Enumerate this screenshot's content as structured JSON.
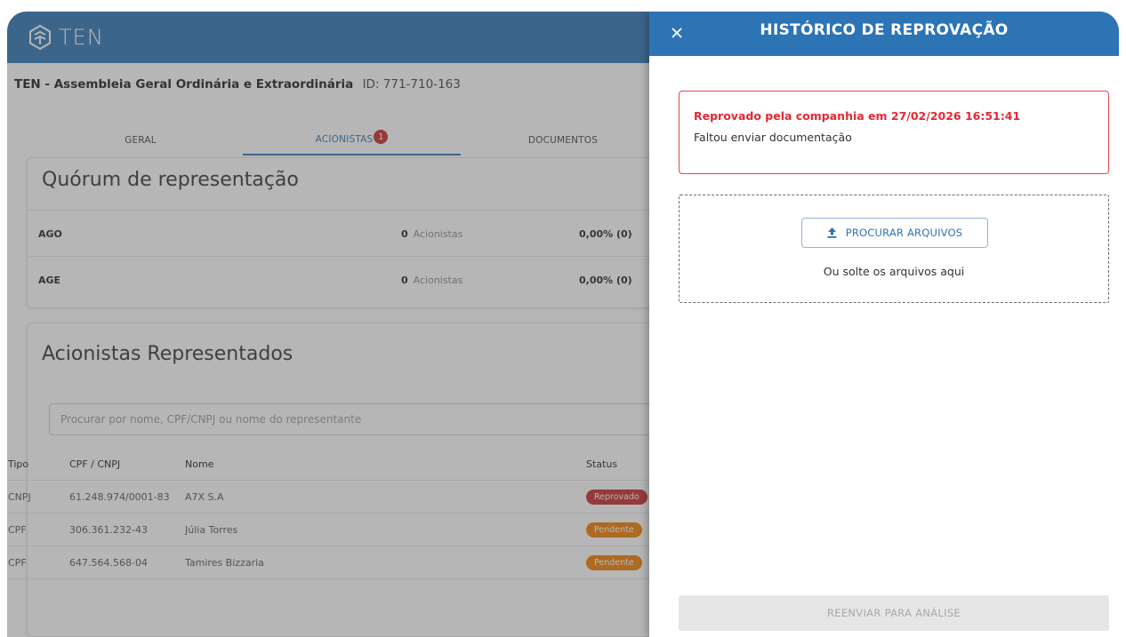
{
  "header": {
    "logo_text": "TEN"
  },
  "assembly": {
    "title": "TEN - Assembleia Geral Ordinária e Extraordinária",
    "id_label": "ID: 771-710-163"
  },
  "tabs": [
    {
      "label": "GERAL"
    },
    {
      "label": "ACIONISTAS",
      "badge": "1"
    },
    {
      "label": "DOCUMENTOS"
    }
  ],
  "quorum": {
    "title": "Quórum de representação",
    "rows": [
      {
        "label": "AGO",
        "count": "0",
        "unit": "Acionistas",
        "percent": "0,00% (0)"
      },
      {
        "label": "AGE",
        "count": "0",
        "unit": "Acionistas",
        "percent": "0,00% (0)"
      }
    ]
  },
  "shareholders": {
    "title": "Acionistas Representados",
    "search_placeholder": "Procurar por nome, CPF/CNPJ ou nome do representante",
    "columns": {
      "tipo": "Tipo",
      "doc": "CPF / CNPJ",
      "nome": "Nome",
      "status": "Status"
    },
    "rows": [
      {
        "tipo": "CNPJ",
        "doc": "61.248.974/0001-83",
        "nome": "A7X S.A",
        "status": "Reprovado",
        "status_color": "#c62828"
      },
      {
        "tipo": "CPF",
        "doc": "306.361.232-43",
        "nome": "Júlia Torres",
        "status": "Pendente",
        "status_color": "#ef7d00"
      },
      {
        "tipo": "CPF",
        "doc": "647.564.568-04",
        "nome": "Tamires Bizzaria",
        "status": "Pendente",
        "status_color": "#ef7d00"
      }
    ]
  },
  "drawer": {
    "title": "HISTÓRICO DE REPROVAÇÃO",
    "rejection": {
      "title": "Reprovado pela companhia em 27/02/2026 16:51:41",
      "message": "Faltou enviar documentação"
    },
    "upload_button": "PROCURAR ARQUIVOS",
    "drop_hint": "Ou solte os arquivos aqui",
    "resubmit_button": "REENVIAR PARA ANÁLISE"
  },
  "colors": {
    "primary": "#2d74b5",
    "danger": "#e02a35",
    "warning": "#ef7d00"
  },
  "icons": [
    "logo-icon",
    "close-icon",
    "upload-icon"
  ]
}
